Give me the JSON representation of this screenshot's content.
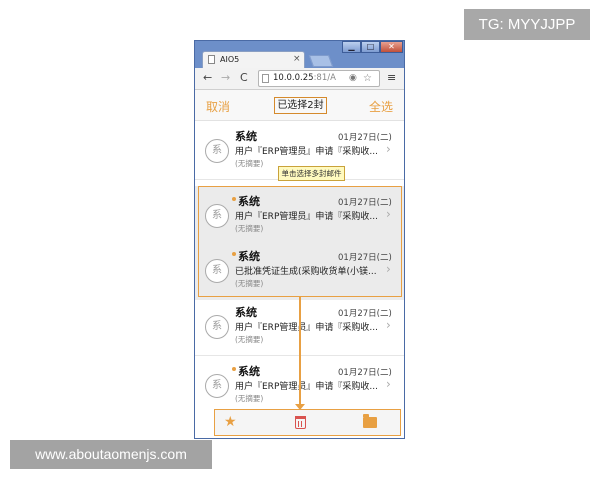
{
  "badges": {
    "tg": "TG: MYYJJPP",
    "site": "www.aboutaomenjs.com"
  },
  "browser": {
    "tab_title": "AIO5",
    "tab_close": "×",
    "url_host": "10.0.0.25",
    "url_rest": ":81/A",
    "nav": {
      "back": "←",
      "forward": "→",
      "reload": "C",
      "menu": "≡"
    },
    "window_buttons": {
      "minimize": "▁",
      "maximize": "□",
      "close": "✕"
    }
  },
  "header": {
    "cancel": "取消",
    "selected": "已选择2封",
    "select_all": "全选"
  },
  "tooltip": "单击选择多封邮件",
  "mails": [
    {
      "avatar": "系",
      "sender": "系统",
      "date": "01月27日(二)",
      "subject": "用户『ERP管理员』申请『采购收...",
      "summary": "(无摘要)",
      "chevron": "›"
    },
    {
      "avatar": "系",
      "sender": "系统",
      "date": "01月27日(二)",
      "subject": "用户『ERP管理员』申请『采购收...",
      "summary": "(无摘要)",
      "chevron": "›"
    },
    {
      "avatar": "系",
      "sender": "系统",
      "date": "01月27日(二)",
      "subject": "已批准凭证生成(采购收货单(小镁...",
      "summary": "(无摘要)",
      "chevron": "›"
    },
    {
      "avatar": "系",
      "sender": "系统",
      "date": "01月27日(二)",
      "subject": "用户『ERP管理员』申请『采购收...",
      "summary": "(无摘要)",
      "chevron": "›"
    },
    {
      "avatar": "系",
      "sender": "系统",
      "date": "01月27日(二)",
      "subject": "用户『ERP管理员』申请『采购收...",
      "summary": "(无摘要)",
      "chevron": "›"
    }
  ],
  "actions": {
    "star": "★"
  },
  "colors": {
    "accent": "#e8a043",
    "delete": "#d9534f",
    "selected_row": "#ebebeb"
  }
}
